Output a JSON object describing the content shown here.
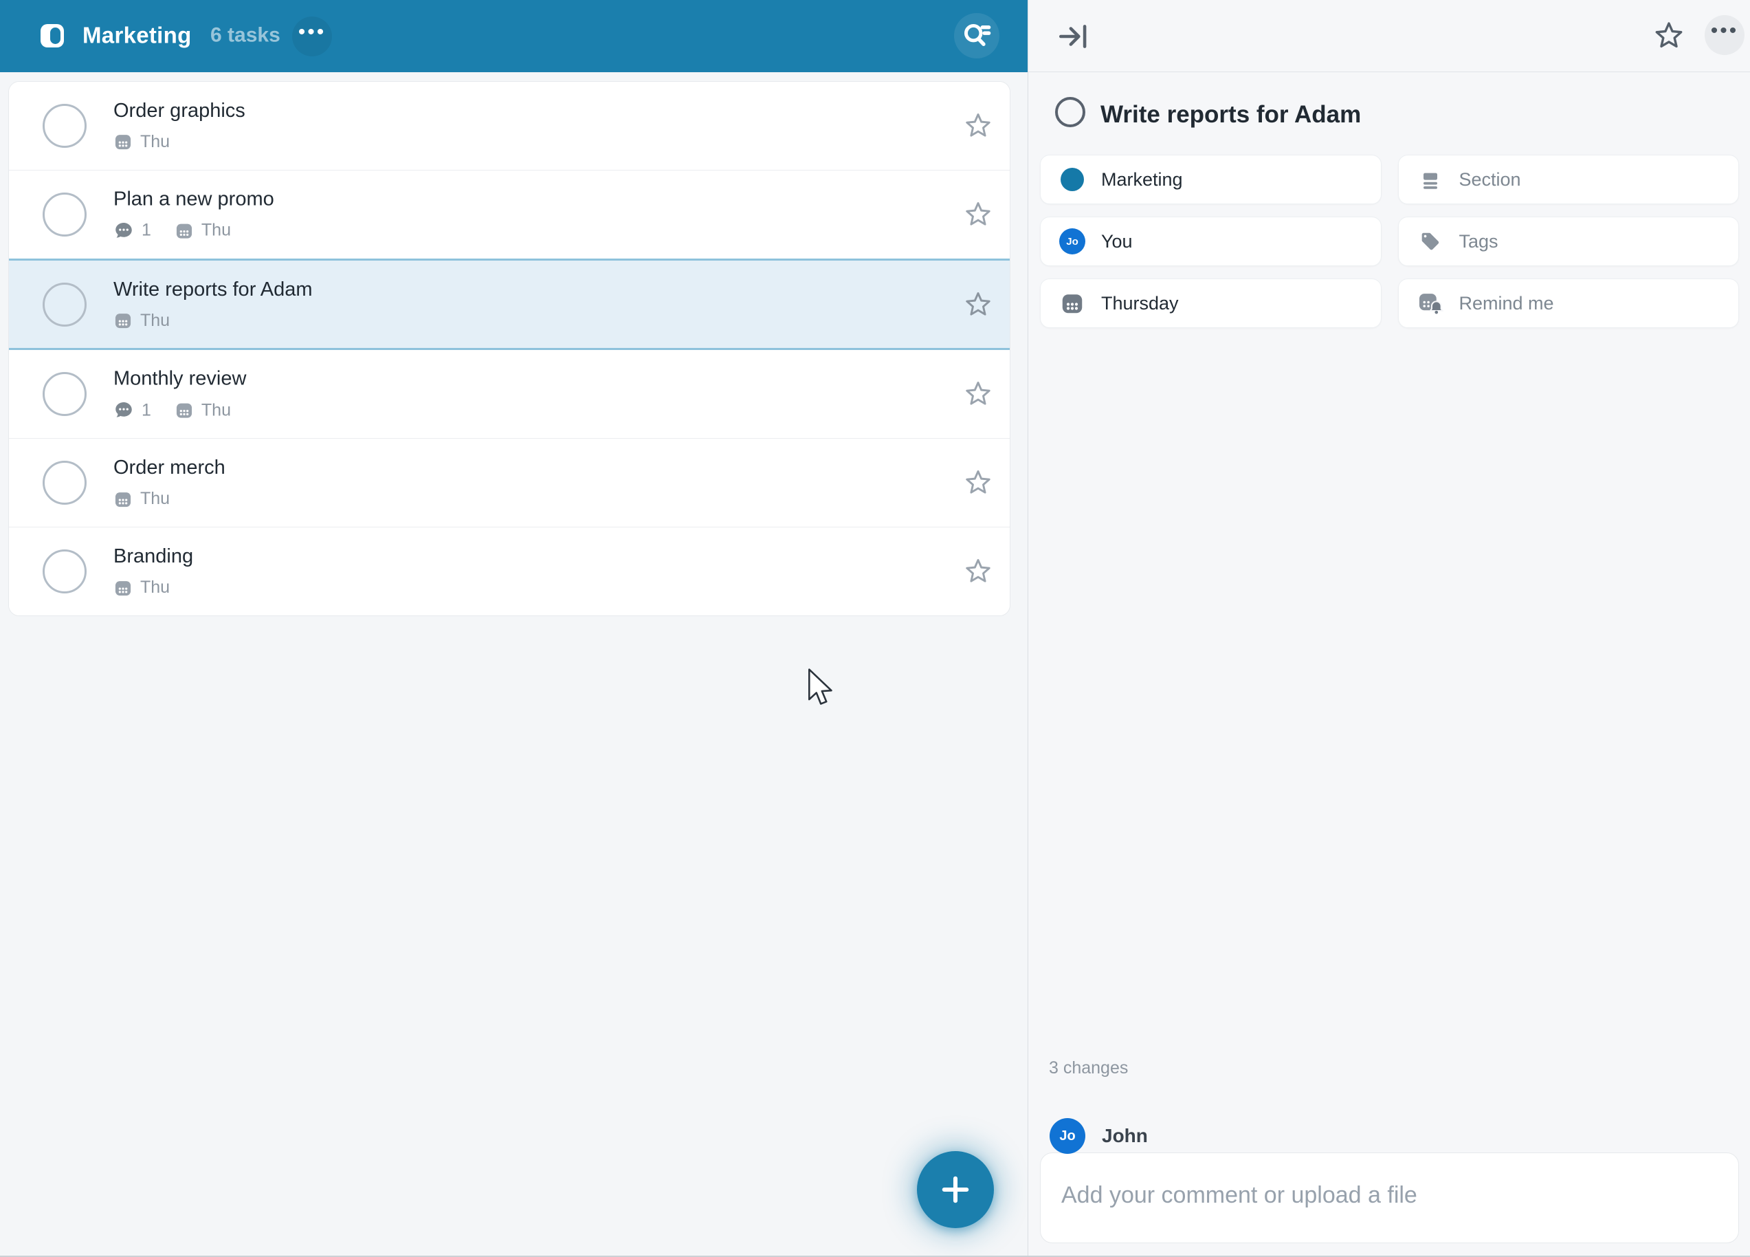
{
  "left_header": {
    "title": "Marketing",
    "task_count": "6 tasks",
    "more_glyph": "•••"
  },
  "tasks": [
    {
      "title": "Order graphics",
      "due": "Thu",
      "comments": "",
      "selected": false
    },
    {
      "title": "Plan a new promo",
      "due": "Thu",
      "comments": "1",
      "selected": false
    },
    {
      "title": "Write reports for Adam",
      "due": "Thu",
      "comments": "",
      "selected": true
    },
    {
      "title": "Monthly review",
      "due": "Thu",
      "comments": "1",
      "selected": false
    },
    {
      "title": "Order merch",
      "due": "Thu",
      "comments": "",
      "selected": false
    },
    {
      "title": "Branding",
      "due": "Thu",
      "comments": "",
      "selected": false
    }
  ],
  "detail": {
    "title": "Write reports for Adam",
    "fields": {
      "list": {
        "label": "Marketing",
        "icon": "list-color-dot"
      },
      "section": {
        "label": "Section",
        "icon": "section-icon"
      },
      "assignee": {
        "label": "You",
        "icon": "avatar",
        "avatar_initials": "Jo"
      },
      "tags": {
        "label": "Tags",
        "icon": "tag-icon"
      },
      "date": {
        "label": "Thursday",
        "icon": "calendar-icon"
      },
      "reminder": {
        "label": "Remind me",
        "icon": "calendar-bell-icon"
      }
    },
    "changes": "3 changes",
    "commenter": {
      "name": "John",
      "avatar_initials": "Jo"
    },
    "comment_placeholder": "Add your comment or upload a file",
    "more_glyph": "•••"
  },
  "colors": {
    "accent_blue": "#1b7fad",
    "avatar_blue": "#1173d4",
    "selected_row_bg": "#e4eff7",
    "selected_row_border": "#8ec2dc",
    "muted_text": "#8d96a0",
    "panel_bg": "#f6f7f9"
  }
}
